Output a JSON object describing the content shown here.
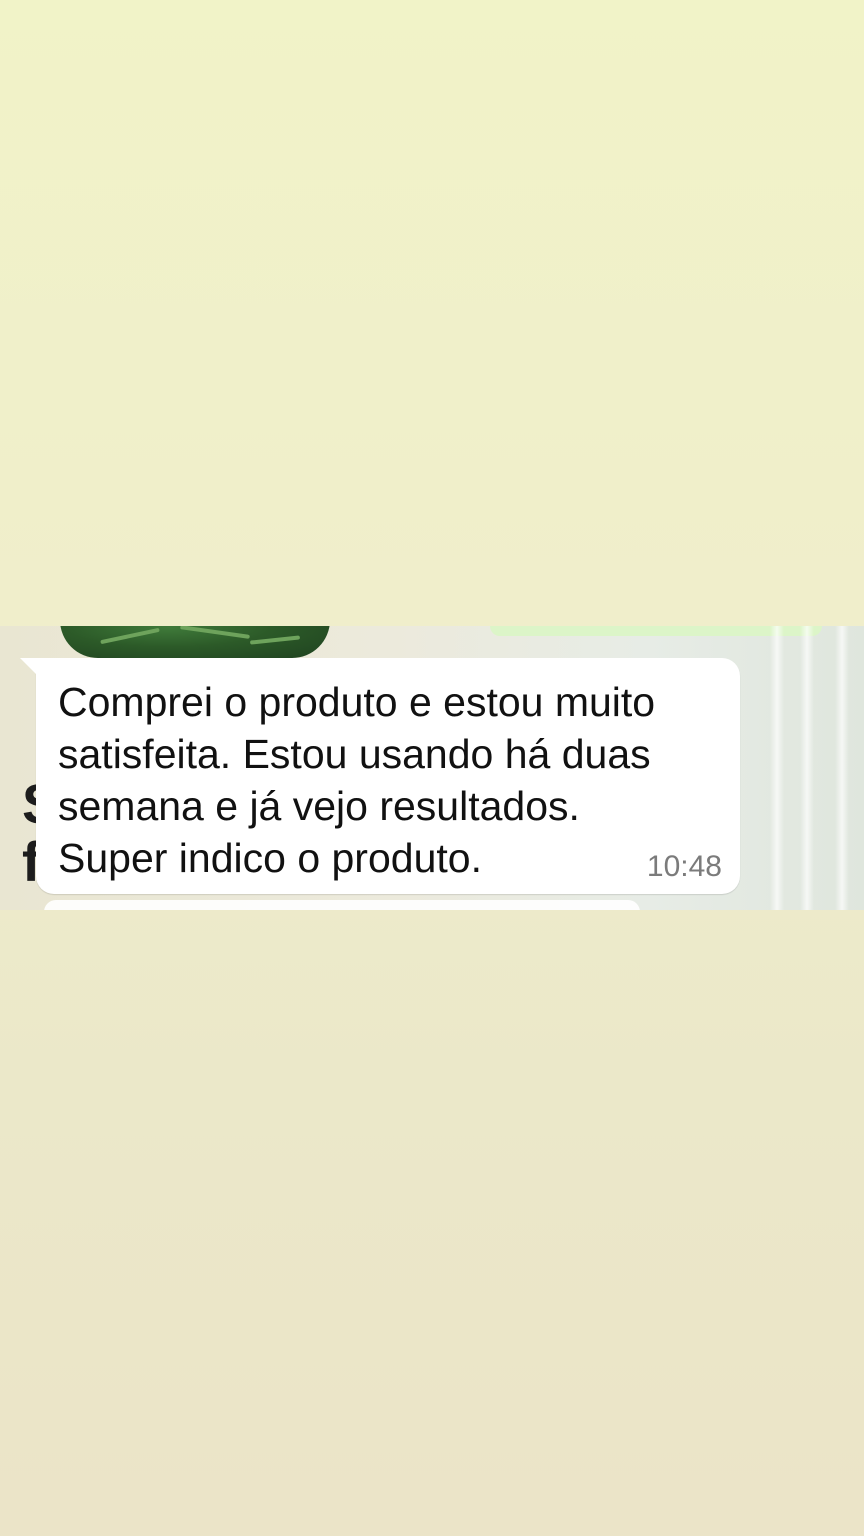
{
  "message": {
    "lines": [
      "Comprei o produto e estou muito",
      "satisfeita. Estou usando há duas",
      "semana e já vejo resultados.",
      "Super indico o produto."
    ],
    "time": "10:48"
  },
  "colors": {
    "page_background": "#f0eecb",
    "bubble": "#ffffff",
    "sent_bubble": "#dcf5c8",
    "text": "#111111",
    "timestamp": "#7b7b7b"
  }
}
